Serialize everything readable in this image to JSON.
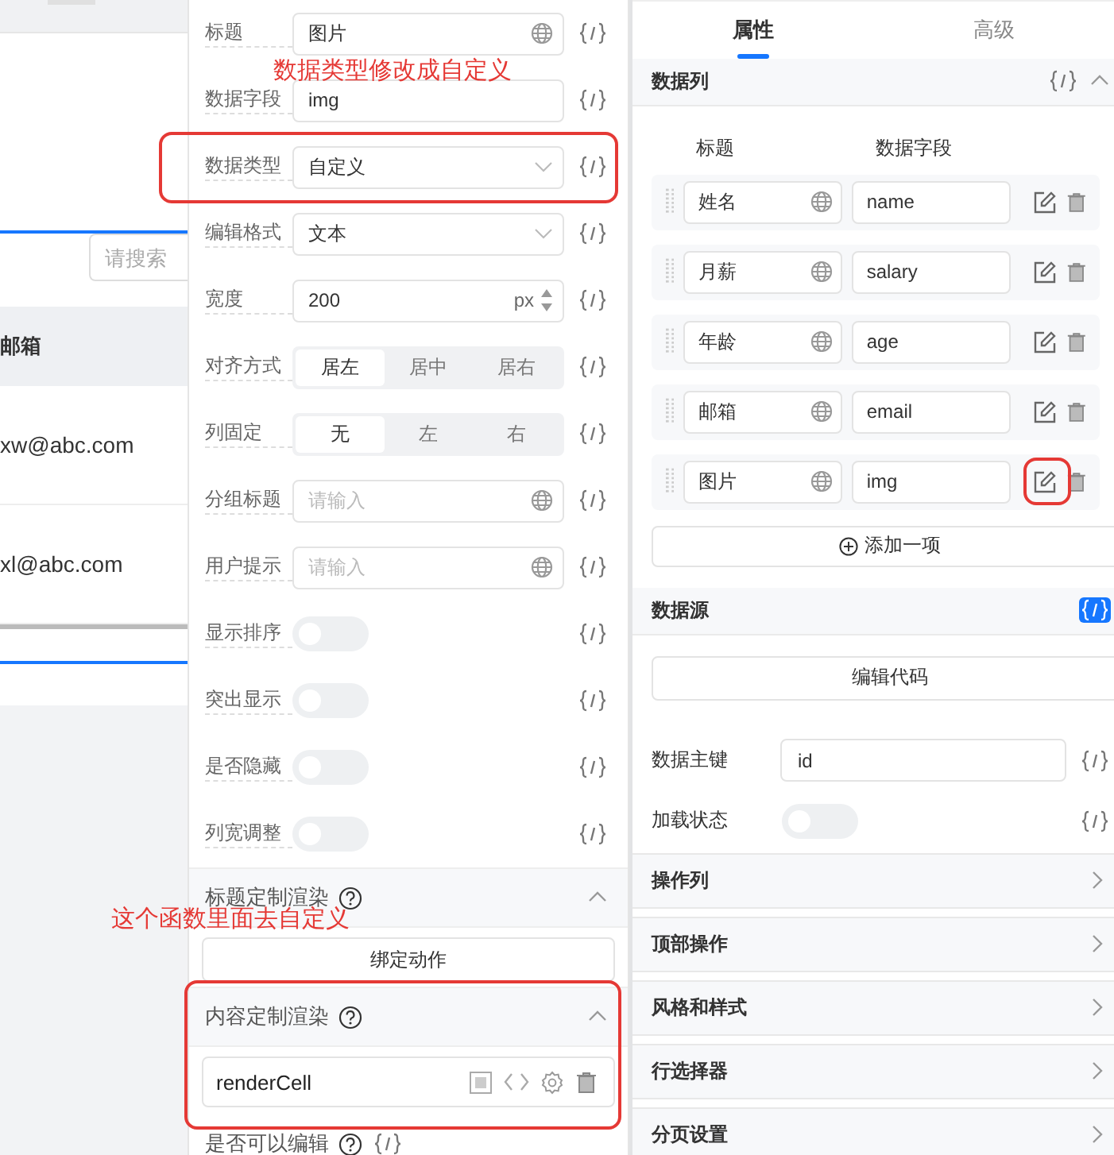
{
  "table_preview": {
    "search": {
      "placeholder": "请搜索"
    },
    "header": "邮箱",
    "rows": [
      "xw@abc.com",
      "xl@abc.com"
    ]
  },
  "column_editor": {
    "fields": [
      {
        "kind": "input",
        "label": "标题",
        "value": "图片",
        "globe": true,
        "annotated": false
      },
      {
        "kind": "input",
        "label": "数据字段",
        "value": "img",
        "globe": false,
        "annotated": false
      },
      {
        "kind": "select",
        "label": "数据类型",
        "value": "自定义",
        "annotated": true
      },
      {
        "kind": "select",
        "label": "编辑格式",
        "value": "文本",
        "annotated": false
      },
      {
        "kind": "number",
        "label": "宽度",
        "value": "200",
        "unit": "px",
        "annotated": false
      },
      {
        "kind": "segmented",
        "label": "对齐方式",
        "options": [
          {
            "label": "居左",
            "selected": true
          },
          {
            "label": "居中",
            "selected": false
          },
          {
            "label": "居右",
            "selected": false
          }
        ],
        "annotated": false
      },
      {
        "kind": "segmented",
        "label": "列固定",
        "options": [
          {
            "label": "无",
            "selected": true
          },
          {
            "label": "左",
            "selected": false
          },
          {
            "label": "右",
            "selected": false
          }
        ],
        "annotated": false
      },
      {
        "kind": "input",
        "label": "分组标题",
        "placeholder": "请输入",
        "globe": true,
        "annotated": false
      },
      {
        "kind": "input",
        "label": "用户提示",
        "placeholder": "请输入",
        "globe": true,
        "annotated": false
      },
      {
        "kind": "toggle",
        "label": "显示排序",
        "on": false,
        "annotated": false
      },
      {
        "kind": "toggle",
        "label": "突出显示",
        "on": false,
        "annotated": false
      },
      {
        "kind": "toggle",
        "label": "是否隐藏",
        "on": false,
        "annotated": false
      },
      {
        "kind": "toggle",
        "label": "列宽调整",
        "on": false,
        "annotated": false
      }
    ],
    "title_render": {
      "title": "标题定制渲染",
      "expanded": true,
      "button": "绑定动作"
    },
    "content_render": {
      "title": "内容定制渲染",
      "expanded": true,
      "function": "renderCell",
      "annotated": true
    },
    "editable": {
      "label": "是否可以编辑"
    }
  },
  "properties": {
    "tabs": [
      {
        "label": "属性",
        "selected": true
      },
      {
        "label": "高级",
        "selected": false
      }
    ],
    "data_columns": {
      "title": "数据列",
      "expanded": true,
      "code_active": false,
      "headers": [
        "标题",
        "数据字段"
      ],
      "rows": [
        {
          "title": "姓名",
          "field": "name",
          "annotated": false
        },
        {
          "title": "月薪",
          "field": "salary",
          "annotated": false
        },
        {
          "title": "年龄",
          "field": "age",
          "annotated": false
        },
        {
          "title": "邮箱",
          "field": "email",
          "annotated": false
        },
        {
          "title": "图片",
          "field": "img",
          "annotated": true
        }
      ],
      "add_button": "添加一项"
    },
    "data_source": {
      "title": "数据源",
      "code_active": true,
      "button": "编辑代码",
      "key_label": "数据主键",
      "key_value": "id",
      "loading_label": "加载状态",
      "loading_on": false
    },
    "sections": [
      {
        "title": "操作列",
        "expanded": false
      },
      {
        "title": "顶部操作",
        "expanded": false
      },
      {
        "title": "风格和样式",
        "expanded": false
      },
      {
        "title": "行选择器",
        "expanded": false
      },
      {
        "title": "分页设置",
        "expanded": false
      }
    ]
  },
  "annotations": [
    "数据类型修改成自定义",
    "这个函数里面去自定义"
  ]
}
